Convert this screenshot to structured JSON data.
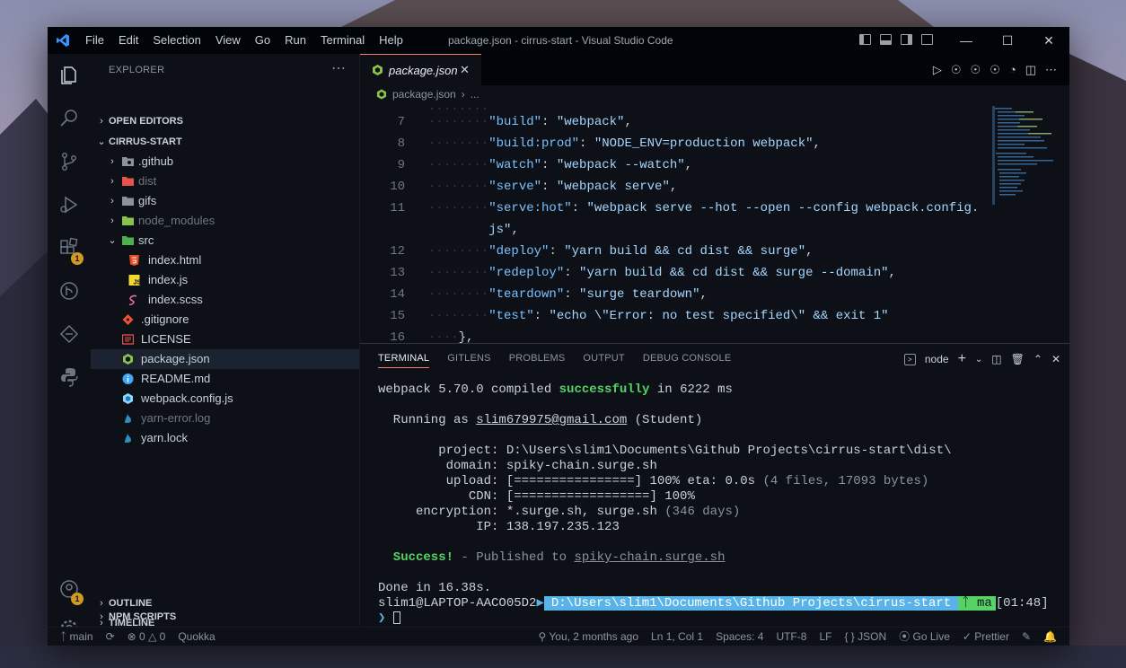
{
  "window": {
    "title": "package.json - cirrus-start - Visual Studio Code",
    "menu": [
      "File",
      "Edit",
      "Selection",
      "View",
      "Go",
      "Run",
      "Terminal",
      "Help"
    ]
  },
  "explorer": {
    "title": "EXPLORER",
    "sections": {
      "open_editors": "OPEN EDITORS",
      "project": "CIRRUS-START",
      "outline": "OUTLINE",
      "timeline": "TIMELINE",
      "npm_scripts": "NPM SCRIPTS"
    },
    "tree": [
      {
        "name": ".github"
      },
      {
        "name": "dist"
      },
      {
        "name": "gifs"
      },
      {
        "name": "node_modules"
      },
      {
        "name": "src"
      },
      {
        "name": "index.html"
      },
      {
        "name": "index.js"
      },
      {
        "name": "index.scss"
      },
      {
        "name": ".gitignore"
      },
      {
        "name": "LICENSE"
      },
      {
        "name": "package.json"
      },
      {
        "name": "README.md"
      },
      {
        "name": "webpack.config.js"
      },
      {
        "name": "yarn-error.log"
      },
      {
        "name": "yarn.lock"
      }
    ]
  },
  "activity_badges": {
    "extensions": "1",
    "accounts": "1",
    "settings": "1"
  },
  "editor": {
    "tab": "package.json",
    "breadcrumb": [
      "package.json",
      "..."
    ],
    "lines": [
      {
        "n": "7",
        "indent": "········",
        "key": "\"build\"",
        "sep": ": ",
        "val": "\"webpack\"",
        "end": ","
      },
      {
        "n": "8",
        "indent": "········",
        "key": "\"build:prod\"",
        "sep": ": ",
        "val": "\"NODE_ENV=production webpack\"",
        "end": ","
      },
      {
        "n": "9",
        "indent": "········",
        "key": "\"watch\"",
        "sep": ": ",
        "val": "\"webpack --watch\"",
        "end": ","
      },
      {
        "n": "10",
        "indent": "········",
        "key": "\"serve\"",
        "sep": ": ",
        "val": "\"webpack serve\"",
        "end": ","
      },
      {
        "n": "11",
        "indent": "········",
        "key": "\"serve:hot\"",
        "sep": ": ",
        "val": "\"webpack serve --hot --open --config webpack.config.",
        "end": ""
      },
      {
        "n": "",
        "indent": "        ",
        "key": "",
        "sep": "",
        "val": "js\"",
        "end": ","
      },
      {
        "n": "12",
        "indent": "········",
        "key": "\"deploy\"",
        "sep": ": ",
        "val": "\"yarn build && cd dist && surge\"",
        "end": ","
      },
      {
        "n": "13",
        "indent": "········",
        "key": "\"redeploy\"",
        "sep": ": ",
        "val": "\"yarn build && cd dist && surge --domain\"",
        "end": ","
      },
      {
        "n": "14",
        "indent": "········",
        "key": "\"teardown\"",
        "sep": ": ",
        "val": "\"surge teardown\"",
        "end": ","
      },
      {
        "n": "15",
        "indent": "········",
        "key": "\"test\"",
        "sep": ": ",
        "val": "\"echo \\\"Error: no test specified\\\" && exit 1\"",
        "end": ""
      },
      {
        "n": "16",
        "indent": "····",
        "key": "",
        "sep": "",
        "val": "",
        "end": "},"
      }
    ]
  },
  "panel": {
    "tabs": [
      "TERMINAL",
      "GITLENS",
      "PROBLEMS",
      "OUTPUT",
      "DEBUG CONSOLE"
    ],
    "shell": "node",
    "terminal": {
      "compiled_pre": "webpack 5.70.0 compiled ",
      "compiled_ok": "successfully",
      "compiled_post": " in 6222 ms",
      "running_pre": "  Running as ",
      "email": "slim679975@gmail.com",
      "running_post": " (Student)",
      "project_label": "        project: ",
      "project_val": "D:\\Users\\slim1\\Documents\\Github Projects\\cirrus-start\\dist\\",
      "domain_label": "         domain: ",
      "domain_val": "spiky-chain.surge.sh",
      "upload_label": "         upload: ",
      "upload_bar": "[================] 100% eta: 0.0s",
      "upload_info": " (4 files, 17093 bytes)",
      "cdn_label": "            CDN: ",
      "cdn_bar": "[==================] 100%",
      "enc_label": "     encryption: ",
      "enc_val": "*.surge.sh, surge.sh",
      "enc_info": " (346 days)",
      "ip_label": "             IP: ",
      "ip_val": "138.197.235.123",
      "success": "  Success!",
      "published_pre": " - Published to ",
      "published_url": "spiky-chain.surge.sh",
      "done": "Done in 16.38s.",
      "host": "slim1@LAPTOP-AACO05D2",
      "path": "D:\\Users\\slim1\\Documents\\Github Projects\\cirrus-start",
      "branch": "ma",
      "time": "[01:48]",
      "prompt": "❯"
    }
  },
  "statusbar": {
    "branch": "main",
    "errors": "0",
    "warnings": "0",
    "quokka": "Quokka",
    "blame": "You, 2 months ago",
    "position": "Ln 1, Col 1",
    "spaces": "Spaces: 4",
    "encoding": "UTF-8",
    "eol": "LF",
    "language": "JSON",
    "golive": "Go Live",
    "prettier": "Prettier"
  }
}
